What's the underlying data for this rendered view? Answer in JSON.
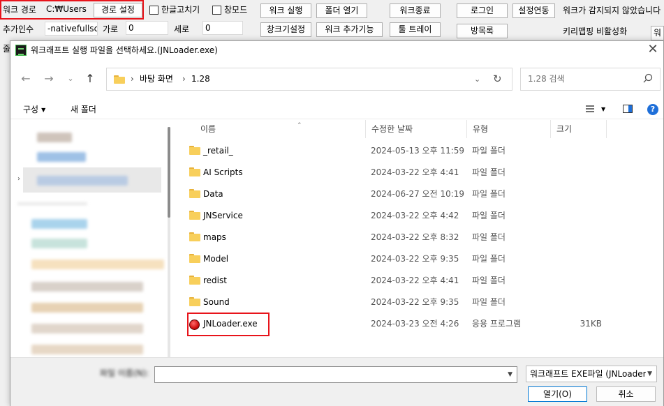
{
  "launcher": {
    "work_path_label": "워크 경로",
    "work_path_value": "C:₩Users",
    "path_set_button": "경로 설정",
    "korean_fix_checkbox": "한글고치기",
    "window_mode_checkbox": "창모드",
    "work_run_button": "워크 실행",
    "open_folder_button": "폴더 열기",
    "work_exit_button": "워크종료",
    "login_button": "로그인",
    "settings_link_button": "설정연동",
    "status_text": "워크가 감지되지 않았습니다",
    "extra_args_label": "추가인수",
    "extra_args_value": "-nativefullsc",
    "width_label": "가로",
    "width_value": "0",
    "height_label": "세로",
    "height_value": "0",
    "window_size_button": "창크기설정",
    "work_addon_button": "워크 추가기능",
    "tray_button": "툴 트레이",
    "guestbook_button": "방목록",
    "keymapping_toggle": "키리맵핑 비활성화",
    "cut_button": "워",
    "cut_label": "줄"
  },
  "dialog": {
    "title": "워크래프트 실행 파일을 선택하세요.(JNLoader.exe)",
    "close_glyph": "✕",
    "nav": {
      "back": "←",
      "forward": "→",
      "dropdown": "⌄",
      "up": "↑"
    },
    "breadcrumb": [
      "바탕 화면",
      "1.28"
    ],
    "breadcrumb_sep": "›",
    "addr_dropdown": "⌄",
    "refresh_glyph": "↻",
    "search_placeholder": "1.28 검색",
    "organize_button": "구성",
    "new_folder_button": "새 폴더",
    "columns": {
      "name": "이름",
      "date": "수정한 날짜",
      "type": "유형",
      "size": "크기"
    },
    "sort_glyph": "⌃",
    "files": [
      {
        "name": "_retail_",
        "date": "2024-05-13 오후 11:59",
        "type": "파일 폴더",
        "size": "",
        "kind": "folder"
      },
      {
        "name": "AI Scripts",
        "date": "2024-03-22 오후 4:41",
        "type": "파일 폴더",
        "size": "",
        "kind": "folder"
      },
      {
        "name": "Data",
        "date": "2024-06-27 오전 10:19",
        "type": "파일 폴더",
        "size": "",
        "kind": "folder"
      },
      {
        "name": "JNService",
        "date": "2024-03-22 오후 4:42",
        "type": "파일 폴더",
        "size": "",
        "kind": "folder"
      },
      {
        "name": "maps",
        "date": "2024-03-22 오후 8:32",
        "type": "파일 폴더",
        "size": "",
        "kind": "folder"
      },
      {
        "name": "Model",
        "date": "2024-03-22 오후 9:35",
        "type": "파일 폴더",
        "size": "",
        "kind": "folder"
      },
      {
        "name": "redist",
        "date": "2024-03-22 오후 4:41",
        "type": "파일 폴더",
        "size": "",
        "kind": "folder"
      },
      {
        "name": "Sound",
        "date": "2024-03-22 오후 9:35",
        "type": "파일 폴더",
        "size": "",
        "kind": "folder"
      },
      {
        "name": "JNLoader.exe",
        "date": "2024-03-23 오전 4:26",
        "type": "응용 프로그램",
        "size": "31KB",
        "kind": "exe"
      }
    ],
    "file_name_label": "파일 이름(N):",
    "file_name_value": "",
    "file_type_value": "워크래프트 EXE파일 (JNLoader",
    "open_button": "열기(O)",
    "cancel_button": "취소"
  },
  "colors": {
    "highlight": "#e8141b",
    "folder": "#f8cf5b",
    "accent": "#0078d4"
  }
}
